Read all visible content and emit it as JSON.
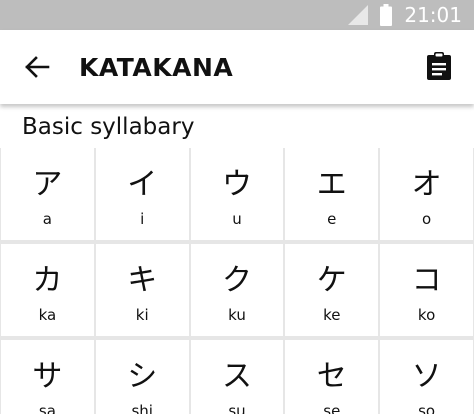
{
  "status_bar": {
    "time": "21:01"
  },
  "app_bar": {
    "title": "KATAKANA"
  },
  "section": {
    "title": "Basic syllabary"
  },
  "kana_grid": [
    {
      "kana": "ア",
      "romaji": "a"
    },
    {
      "kana": "イ",
      "romaji": "i"
    },
    {
      "kana": "ウ",
      "romaji": "u"
    },
    {
      "kana": "エ",
      "romaji": "e"
    },
    {
      "kana": "オ",
      "romaji": "o"
    },
    {
      "kana": "カ",
      "romaji": "ka"
    },
    {
      "kana": "キ",
      "romaji": "ki"
    },
    {
      "kana": "ク",
      "romaji": "ku"
    },
    {
      "kana": "ケ",
      "romaji": "ke"
    },
    {
      "kana": "コ",
      "romaji": "ko"
    },
    {
      "kana": "サ",
      "romaji": "sa"
    },
    {
      "kana": "シ",
      "romaji": "shi"
    },
    {
      "kana": "ス",
      "romaji": "su"
    },
    {
      "kana": "セ",
      "romaji": "se"
    },
    {
      "kana": "ソ",
      "romaji": "so"
    }
  ],
  "icons": {
    "back": "arrow-back-icon",
    "clipboard": "clipboard-icon",
    "signal": "signal-icon",
    "battery": "battery-icon"
  }
}
